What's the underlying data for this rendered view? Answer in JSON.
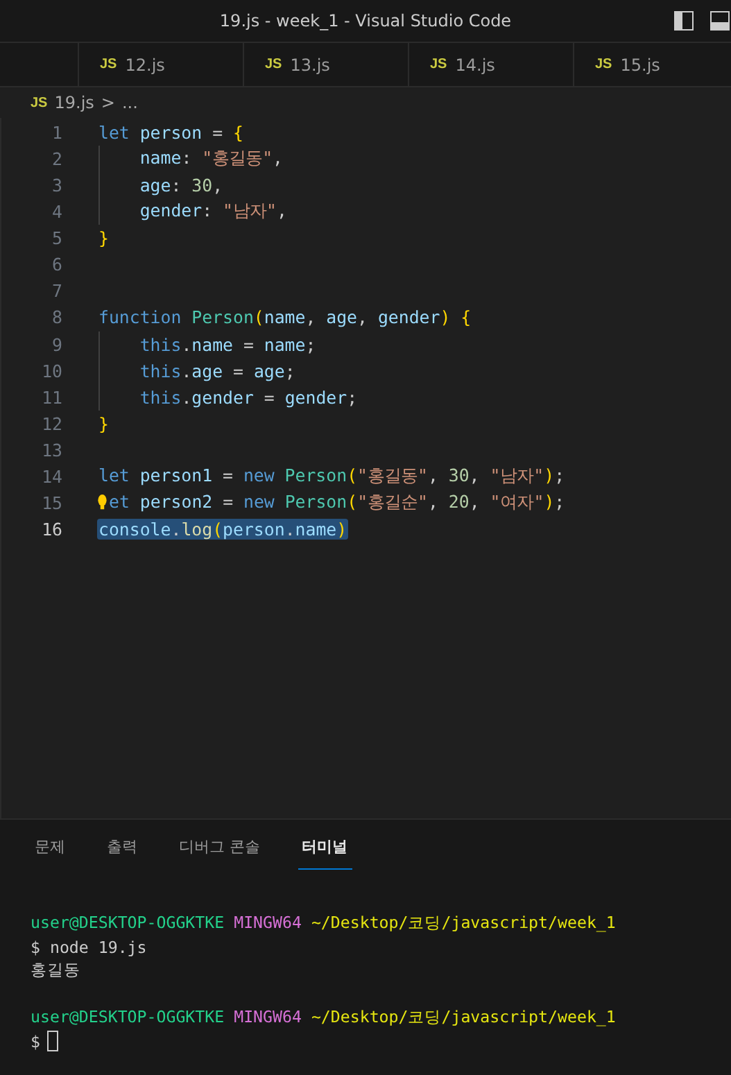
{
  "window": {
    "title": "19.js - week_1 - Visual Studio Code"
  },
  "tabs": [
    {
      "icon": "JS",
      "label": "12.js",
      "selected": false
    },
    {
      "icon": "JS",
      "label": "13.js",
      "selected": false
    },
    {
      "icon": "JS",
      "label": "14.js",
      "selected": false
    },
    {
      "icon": "JS",
      "label": "15.js",
      "selected": false
    }
  ],
  "breadcrumb": {
    "icon": "JS",
    "file": "19.js",
    "separator": ">",
    "rest": "..."
  },
  "editor": {
    "lines": [
      {
        "number": "1",
        "selected": false,
        "lightbulb": false,
        "tokens": [
          {
            "kind": "keyword",
            "t": "let "
          },
          {
            "kind": "variable",
            "t": "person"
          },
          {
            "kind": "punct",
            "t": " = "
          },
          {
            "kind": "bracket",
            "t": "{"
          }
        ]
      },
      {
        "number": "2",
        "selected": false,
        "lightbulb": false,
        "tokens": [
          {
            "kind": "variable",
            "t": "    name"
          },
          {
            "kind": "punct",
            "t": ": "
          },
          {
            "kind": "string",
            "t": "\"홍길동\""
          },
          {
            "kind": "punct",
            "t": ","
          }
        ]
      },
      {
        "number": "3",
        "selected": false,
        "lightbulb": false,
        "tokens": [
          {
            "kind": "variable",
            "t": "    age"
          },
          {
            "kind": "punct",
            "t": ": "
          },
          {
            "kind": "number",
            "t": "30"
          },
          {
            "kind": "punct",
            "t": ","
          }
        ]
      },
      {
        "number": "4",
        "selected": false,
        "lightbulb": false,
        "tokens": [
          {
            "kind": "variable",
            "t": "    gender"
          },
          {
            "kind": "punct",
            "t": ": "
          },
          {
            "kind": "string",
            "t": "\"남자\""
          },
          {
            "kind": "punct",
            "t": ","
          }
        ]
      },
      {
        "number": "5",
        "selected": false,
        "lightbulb": false,
        "tokens": [
          {
            "kind": "bracket",
            "t": "}"
          }
        ]
      },
      {
        "number": "6",
        "selected": false,
        "lightbulb": false
      },
      {
        "number": "7",
        "selected": false,
        "lightbulb": false
      },
      {
        "number": "8",
        "selected": false,
        "lightbulb": false,
        "tokens": [
          {
            "kind": "keyword",
            "t": "function "
          },
          {
            "kind": "class",
            "t": "Person"
          },
          {
            "kind": "bracket",
            "t": "("
          },
          {
            "kind": "variable",
            "t": "name"
          },
          {
            "kind": "punct",
            "t": ", "
          },
          {
            "kind": "variable",
            "t": "age"
          },
          {
            "kind": "punct",
            "t": ", "
          },
          {
            "kind": "variable",
            "t": "gender"
          },
          {
            "kind": "bracket",
            "t": ")"
          },
          {
            "kind": "bracket",
            "t": " {"
          }
        ]
      },
      {
        "number": "9",
        "selected": false,
        "lightbulb": false,
        "tokens": [
          {
            "kind": "keyword",
            "t": "    this"
          },
          {
            "kind": "punct",
            "t": "."
          },
          {
            "kind": "variable",
            "t": "name"
          },
          {
            "kind": "punct",
            "t": " = "
          },
          {
            "kind": "variable",
            "t": "name"
          },
          {
            "kind": "punct",
            "t": ";"
          }
        ]
      },
      {
        "number": "10",
        "selected": false,
        "lightbulb": false,
        "tokens": [
          {
            "kind": "keyword",
            "t": "    this"
          },
          {
            "kind": "punct",
            "t": "."
          },
          {
            "kind": "variable",
            "t": "age"
          },
          {
            "kind": "punct",
            "t": " = "
          },
          {
            "kind": "variable",
            "t": "age"
          },
          {
            "kind": "punct",
            "t": ";"
          }
        ]
      },
      {
        "number": "11",
        "selected": false,
        "lightbulb": false,
        "tokens": [
          {
            "kind": "keyword",
            "t": "    this"
          },
          {
            "kind": "punct",
            "t": "."
          },
          {
            "kind": "variable",
            "t": "gender"
          },
          {
            "kind": "punct",
            "t": " = "
          },
          {
            "kind": "variable",
            "t": "gender"
          },
          {
            "kind": "punct",
            "t": ";"
          }
        ]
      },
      {
        "number": "12",
        "selected": false,
        "lightbulb": false,
        "tokens": [
          {
            "kind": "bracket",
            "t": "}"
          }
        ]
      },
      {
        "number": "13",
        "selected": false,
        "lightbulb": false
      },
      {
        "number": "14",
        "selected": false,
        "lightbulb": false,
        "tokens": [
          {
            "kind": "keyword",
            "t": "let "
          },
          {
            "kind": "variable",
            "t": "person1"
          },
          {
            "kind": "punct",
            "t": " = "
          },
          {
            "kind": "keyword",
            "t": "new "
          },
          {
            "kind": "class",
            "t": "Person"
          },
          {
            "kind": "bracket",
            "t": "("
          },
          {
            "kind": "string",
            "t": "\"홍길동\""
          },
          {
            "kind": "punct",
            "t": ", "
          },
          {
            "kind": "number",
            "t": "30"
          },
          {
            "kind": "punct",
            "t": ", "
          },
          {
            "kind": "string",
            "t": "\"남자\""
          },
          {
            "kind": "bracket",
            "t": ")"
          },
          {
            "kind": "punct",
            "t": ";"
          }
        ]
      },
      {
        "number": "15",
        "selected": false,
        "lightbulb": true,
        "tokens": [
          {
            "kind": "keyword",
            "t": "et "
          },
          {
            "kind": "variable",
            "t": "person2"
          },
          {
            "kind": "punct",
            "t": " = "
          },
          {
            "kind": "keyword",
            "t": "new "
          },
          {
            "kind": "class",
            "t": "Person"
          },
          {
            "kind": "bracket",
            "t": "("
          },
          {
            "kind": "string",
            "t": "\"홍길순\""
          },
          {
            "kind": "punct",
            "t": ", "
          },
          {
            "kind": "number",
            "t": "20"
          },
          {
            "kind": "punct",
            "t": ", "
          },
          {
            "kind": "string",
            "t": "\"여자\""
          },
          {
            "kind": "bracket",
            "t": ")"
          },
          {
            "kind": "punct",
            "t": ";"
          }
        ]
      },
      {
        "number": "16",
        "selected": true,
        "lightbulb": false,
        "tokens": [
          {
            "kind": "variable",
            "t": "console"
          },
          {
            "kind": "punct",
            "t": "."
          },
          {
            "kind": "function",
            "t": "log"
          },
          {
            "kind": "bracket",
            "t": "("
          },
          {
            "kind": "variable",
            "t": "person"
          },
          {
            "kind": "punct",
            "t": "."
          },
          {
            "kind": "variable",
            "t": "name"
          },
          {
            "kind": "bracket",
            "t": ")"
          }
        ]
      }
    ]
  },
  "panel": {
    "tabs": [
      {
        "label": "문제",
        "selected": false
      },
      {
        "label": "출력",
        "selected": false
      },
      {
        "label": "디버그 콘솔",
        "selected": false
      },
      {
        "label": "터미널",
        "selected": true
      }
    ],
    "terminal": [
      {
        "segments": [
          {
            "kind": "user",
            "t": "user@DESKTOP-OGGKTKE "
          },
          {
            "kind": "host",
            "t": "MINGW64 "
          },
          {
            "kind": "path",
            "t": "~/Desktop/코딩/javascript/week_1"
          }
        ]
      },
      {
        "segments": [
          {
            "kind": "plain",
            "t": "$ node 19.js"
          }
        ]
      },
      {
        "segments": [
          {
            "kind": "plain",
            "t": "홍길동"
          }
        ]
      },
      {
        "cursor": false
      },
      {
        "segments": [
          {
            "kind": "user",
            "t": "user@DESKTOP-OGGKTKE "
          },
          {
            "kind": "host",
            "t": "MINGW64 "
          },
          {
            "kind": "path",
            "t": "~/Desktop/코딩/javascript/week_1"
          }
        ]
      },
      {
        "segments": [
          {
            "kind": "plain",
            "t": "$"
          }
        ],
        "cursor": true
      }
    ]
  }
}
